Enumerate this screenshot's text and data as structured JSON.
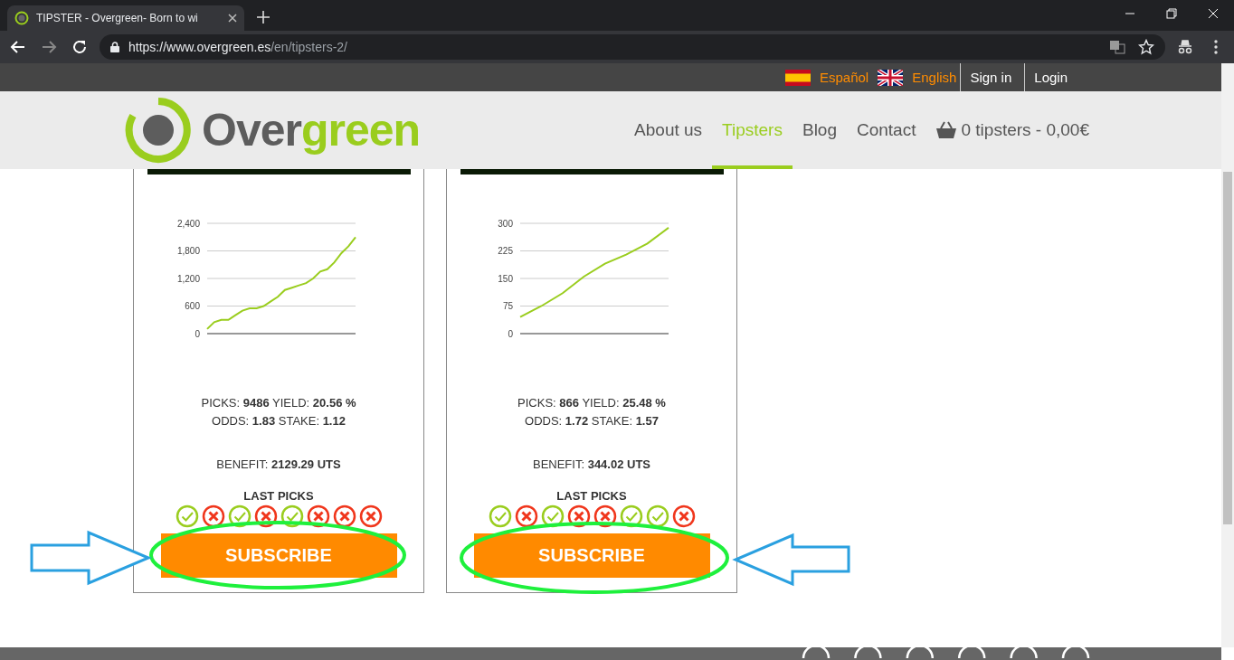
{
  "browser": {
    "tab_title": "TIPSTER - Overgreen- Born to wi",
    "url_host": "https://www.overgreen.es",
    "url_path": "/en/tipsters-2/"
  },
  "top_bar": {
    "languages": [
      {
        "label": "Español",
        "kind": "es"
      },
      {
        "label": "English",
        "kind": "uk"
      }
    ],
    "links": [
      "Sign in",
      "Login"
    ]
  },
  "header": {
    "logo_main": "Over",
    "logo_accent": "green",
    "nav": [
      {
        "label": "About us",
        "selected": false
      },
      {
        "label": "Tipsters",
        "selected": true
      },
      {
        "label": "Blog",
        "selected": false
      },
      {
        "label": "Contact",
        "selected": false
      }
    ],
    "cart": "0 tipsters - 0,00€"
  },
  "cards": [
    {
      "chart_data": {
        "type": "line",
        "grid": true,
        "ylim": [
          0,
          2400
        ],
        "yticks": [
          {
            "value": 0,
            "label": "0"
          },
          {
            "value": 600,
            "label": "600"
          },
          {
            "value": 1200,
            "label": "1,200"
          },
          {
            "value": 1800,
            "label": "1,800"
          },
          {
            "value": 2400,
            "label": "2,400"
          }
        ],
        "series": [
          {
            "color": "#9acd1e",
            "values": [
              100,
              250,
              300,
              300,
              400,
              500,
              550,
              550,
              600,
              700,
              800,
              950,
              1000,
              1050,
              1100,
              1200,
              1350,
              1400,
              1550,
              1750,
              1900,
              2100
            ]
          }
        ]
      },
      "stats_line_1": "PICKS: **9486** YIELD: **20.56 %**",
      "stats_line_2": "ODDS: **1.83** STAKE: **1.12**",
      "benefit": "BENEFIT: **2129.29 UTS**",
      "last_picks_label": "LAST PICKS",
      "last_picks": [
        {
          "kind": "win"
        },
        {
          "kind": "loss"
        },
        {
          "kind": "win"
        },
        {
          "kind": "loss"
        },
        {
          "kind": "win"
        },
        {
          "kind": "loss"
        },
        {
          "kind": "loss"
        },
        {
          "kind": "loss"
        }
      ],
      "button": "SUBSCRIBE"
    },
    {
      "chart_data": {
        "type": "line",
        "grid": true,
        "ylim": [
          0,
          300
        ],
        "yticks": [
          {
            "value": 0,
            "label": "0"
          },
          {
            "value": 75,
            "label": "75"
          },
          {
            "value": 150,
            "label": "150"
          },
          {
            "value": 225,
            "label": "225"
          },
          {
            "value": 300,
            "label": "300"
          }
        ],
        "series": [
          {
            "color": "#9acd1e",
            "values": [
              45,
              75,
              110,
              155,
              190,
              215,
              245,
              288
            ]
          }
        ]
      },
      "stats_line_1": "PICKS: **866** YIELD: **25.48 %**",
      "stats_line_2": "ODDS: **1.72** STAKE: **1.57**",
      "benefit": "BENEFIT: **344.02 UTS**",
      "last_picks_label": "LAST PICKS",
      "last_picks": [
        {
          "kind": "win"
        },
        {
          "kind": "loss"
        },
        {
          "kind": "win"
        },
        {
          "kind": "loss"
        },
        {
          "kind": "loss"
        },
        {
          "kind": "win"
        },
        {
          "kind": "win"
        },
        {
          "kind": "loss"
        }
      ],
      "button": "SUBSCRIBE"
    }
  ]
}
